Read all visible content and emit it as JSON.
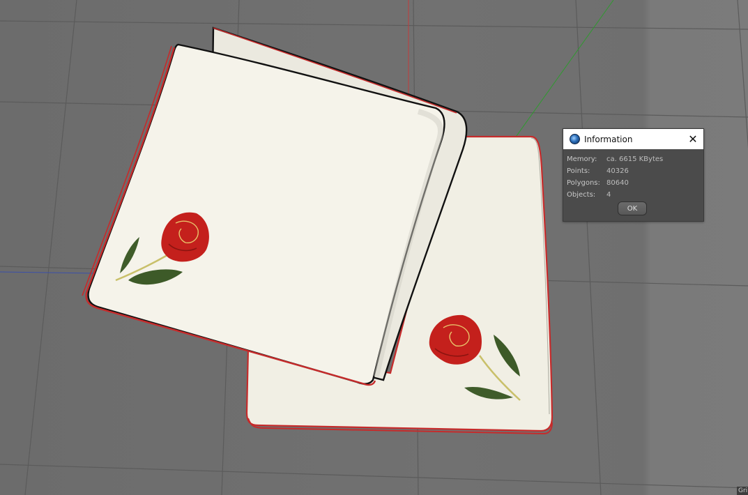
{
  "dialog": {
    "title": "Information",
    "rows": [
      {
        "label": "Memory:",
        "value": "ca. 6615 KBytes"
      },
      {
        "label": "Points:",
        "value": "40326"
      },
      {
        "label": "Polygons:",
        "value": "80640"
      },
      {
        "label": "Objects:",
        "value": "4"
      }
    ],
    "ok_label": "OK",
    "close_glyph": "✕"
  },
  "viewport": {
    "corner_label": "Gri",
    "colors": {
      "background": "#6e6e6e",
      "grid_line": "#5a5a5a",
      "x_axis": "#c23b3b",
      "y_axis": "#2f8a2f",
      "z_axis": "#3b4fa8",
      "napkin": "#f2f0e6",
      "napkin_edge": "#c62b2b",
      "rose": "#c4201c",
      "leaf": "#3d5a28"
    }
  },
  "icons": {
    "app": "cinema4d-app-icon",
    "close": "close-icon"
  }
}
